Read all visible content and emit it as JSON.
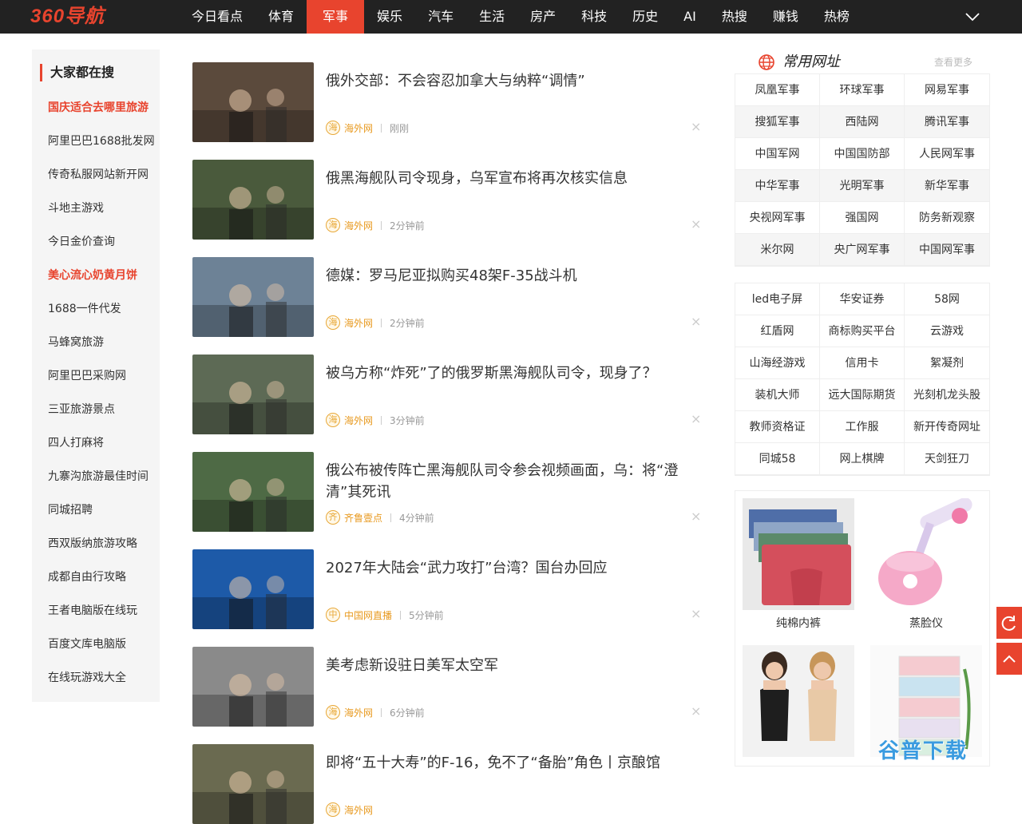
{
  "header": {
    "logo": "360导航",
    "nav": [
      {
        "label": "今日看点"
      },
      {
        "label": "体育"
      },
      {
        "label": "军事",
        "active": true
      },
      {
        "label": "娱乐"
      },
      {
        "label": "汽车"
      },
      {
        "label": "生活"
      },
      {
        "label": "房产"
      },
      {
        "label": "科技"
      },
      {
        "label": "历史"
      },
      {
        "label": "AI"
      },
      {
        "label": "热搜"
      },
      {
        "label": "赚钱"
      },
      {
        "label": "热榜"
      }
    ],
    "more_icon": "chevron-down-icon"
  },
  "sidebar": {
    "title": "大家都在搜",
    "items": [
      {
        "label": "国庆适合去哪里旅游",
        "hot": true
      },
      {
        "label": "阿里巴巴1688批发网"
      },
      {
        "label": "传奇私服网站新开网"
      },
      {
        "label": "斗地主游戏"
      },
      {
        "label": "今日金价查询"
      },
      {
        "label": "美心流心奶黄月饼",
        "hot": true
      },
      {
        "label": "1688一件代发"
      },
      {
        "label": "马蜂窝旅游"
      },
      {
        "label": "阿里巴巴采购网"
      },
      {
        "label": "三亚旅游景点"
      },
      {
        "label": "四人打麻将"
      },
      {
        "label": "九寨沟旅游最佳时间"
      },
      {
        "label": "同城招聘"
      },
      {
        "label": "西双版纳旅游攻略"
      },
      {
        "label": "成都自由行攻略"
      },
      {
        "label": "王者电脑版在线玩"
      },
      {
        "label": "百度文库电脑版"
      },
      {
        "label": "在线玩游戏大全"
      }
    ]
  },
  "feed": [
    {
      "title": "俄外交部：不会容忍加拿大与纳粹“调情”",
      "source_icon": "海",
      "source": "海外网",
      "time": "刚刚",
      "img_color": "#5b4a3c"
    },
    {
      "title": "俄黑海舰队司令现身，乌军宣布将再次核实信息",
      "source_icon": "海",
      "source": "海外网",
      "time": "2分钟前",
      "img_color": "#4a5a3c"
    },
    {
      "title": "德媒：罗马尼亚拟购买48架F-35战斗机",
      "source_icon": "海",
      "source": "海外网",
      "time": "2分钟前",
      "img_color": "#6d8296"
    },
    {
      "title": "被乌方称“炸死”了的俄罗斯黑海舰队司令，现身了？",
      "source_icon": "海",
      "source": "海外网",
      "time": "3分钟前",
      "img_color": "#5d6a55"
    },
    {
      "title": "俄公布被传阵亡黑海舰队司令参会视频画面，乌：将“澄清”其死讯",
      "source_icon": "齐",
      "source": "齐鲁壹点",
      "time": "4分钟前",
      "img_color": "#4e6a45"
    },
    {
      "title": "2027年大陆会“武力攻打”台湾？国台办回应",
      "source_icon": "中",
      "source": "中国网直播",
      "time": "5分钟前",
      "img_color": "#1d5aa8"
    },
    {
      "title": "美考虑新设驻日美军太空军",
      "source_icon": "海",
      "source": "海外网",
      "time": "6分钟前",
      "img_color": "#8a8a8a"
    },
    {
      "title": "即将“五十大寿”的F-16，免不了“备胎”角色丨京酿馆",
      "source_icon": "海",
      "source": "海外网",
      "time": "",
      "img_color": "#6a6a50"
    }
  ],
  "sites": {
    "title": "常用网址",
    "more": "查看更多",
    "military": [
      "凤凰军事",
      "环球军事",
      "网易军事",
      "搜狐军事",
      "西陆网",
      "腾讯军事",
      "中国军网",
      "中国国防部",
      "人民网军事",
      "中华军事",
      "光明军事",
      "新华军事",
      "央视网军事",
      "强国网",
      "防务新观察",
      "米尔网",
      "央广网军事",
      "中国网军事"
    ],
    "promo": [
      "led电子屏",
      "华安证券",
      "58网",
      "红盾网",
      "商标购买平台",
      "云游戏",
      "山海经游戏",
      "信用卡",
      "絮凝剂",
      "装机大师",
      "远大国际期货",
      "光刻机龙头股",
      "教师资格证",
      "工作服",
      "新开传奇网址",
      "同城58",
      "网上棋牌",
      "天剑狂刀"
    ]
  },
  "shop": [
    {
      "name": "纯棉内裤"
    },
    {
      "name": "蒸脸仪"
    },
    {
      "name": ""
    },
    {
      "name": ""
    }
  ],
  "watermark": "谷普下载",
  "colors": {
    "brand": "#e8442e",
    "nav_bg": "#222222",
    "source": "#e89a20"
  }
}
